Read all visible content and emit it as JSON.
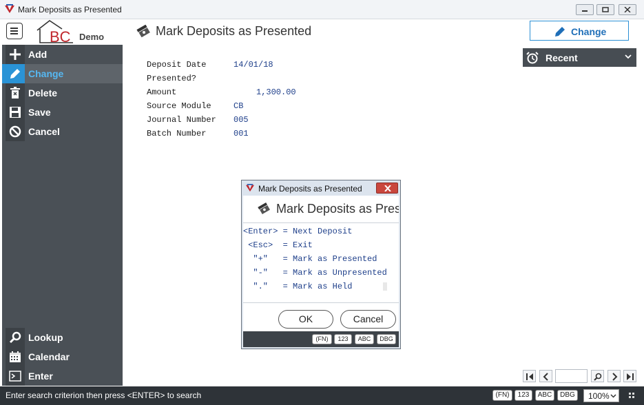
{
  "window": {
    "title": "Mark Deposits as Presented"
  },
  "header": {
    "logo_text": "BC",
    "logo_sub": "Demo",
    "page_title": "Mark Deposits as Presented",
    "change_label": "Change"
  },
  "sidebar": {
    "items": [
      {
        "label": "Add",
        "icon": "plus-icon"
      },
      {
        "label": "Change",
        "icon": "pencil-icon",
        "active": true
      },
      {
        "label": "Delete",
        "icon": "trash-icon"
      },
      {
        "label": "Save",
        "icon": "floppy-icon"
      },
      {
        "label": "Cancel",
        "icon": "cancel-icon"
      }
    ],
    "bottom_items": [
      {
        "label": "Lookup",
        "icon": "search-icon"
      },
      {
        "label": "Calendar",
        "icon": "calendar-icon"
      },
      {
        "label": "Enter",
        "icon": "terminal-icon"
      }
    ]
  },
  "form": {
    "fields": [
      {
        "label": "Deposit Date",
        "value": "14/01/18"
      },
      {
        "label": "Presented?",
        "value": ""
      },
      {
        "label": "Amount",
        "value": "1,300.00"
      },
      {
        "label": "Source Module",
        "value": "CB"
      },
      {
        "label": "Journal Number",
        "value": "005"
      },
      {
        "label": "Batch Number",
        "value": "001"
      }
    ]
  },
  "recent": {
    "label": "Recent"
  },
  "dialog": {
    "title": "Mark Deposits as Presented",
    "heading": "Mark Deposits as Presented",
    "lines": [
      "<Enter> = Next Deposit",
      " <Esc>  = Exit",
      "  \"+\"   = Mark as Presented",
      "  \"-\"   = Mark as Unpresented",
      "  \".\"   = Mark as Held"
    ],
    "ok_label": "OK",
    "cancel_label": "Cancel",
    "badges": [
      "(FN)",
      "123",
      "ABC",
      "DBG"
    ]
  },
  "statusbar": {
    "message": "Enter search criterion then press <ENTER> to search",
    "badges": [
      "(FN)",
      "123",
      "ABC",
      "DBG"
    ],
    "zoom": "100%"
  },
  "colors": {
    "accent": "#2a93d6",
    "sidebar_bg": "#4a5056",
    "statusbar_bg": "#2e3338",
    "value_text": "#1e3f8a"
  }
}
